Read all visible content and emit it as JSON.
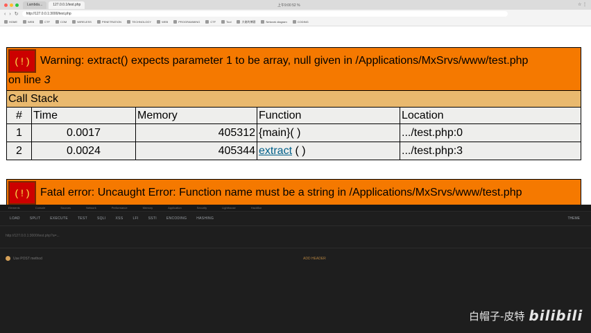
{
  "browser": {
    "tabs": [
      "Lambda...",
      "127.0.0.1/test.php"
    ],
    "active_tab_index": 1,
    "center_status": "上午9:00 52 %",
    "url": "http://127.0.0.1:3000/test.php",
    "nav": {
      "back": "‹",
      "forward": "›",
      "reload": "↻"
    },
    "right_icons": "☆ ⋮",
    "bookmarks": [
      "HOME",
      "WEB",
      "CTF",
      "COM",
      "WIRELESS",
      "PENETRATION",
      "TECHNOLOGY",
      "WEB",
      "PROGRAMMING",
      "CTF",
      "Tool",
      "大佬的博客",
      "Network diagram",
      "CODING"
    ]
  },
  "xdebug": {
    "warning": {
      "icon": "( ! )",
      "message": "Warning: extract() expects parameter 1 to be array, null given in /Applications/MxSrvs/www/test.php",
      "line_prefix": "on line ",
      "line": "3"
    },
    "call_stack_label": "Call Stack",
    "columns": [
      "#",
      "Time",
      "Memory",
      "Function",
      "Location"
    ],
    "rows": [
      {
        "num": "1",
        "time": "0.0017",
        "memory": "405312",
        "function": "{main}( )",
        "function_is_link": false,
        "location": ".../test.php:0"
      },
      {
        "num": "2",
        "time": "0.0024",
        "memory": "405344",
        "function": "extract",
        "function_suffix": " ( )",
        "function_is_link": true,
        "location": ".../test.php:3"
      }
    ],
    "fatal": {
      "icon": "( ! )",
      "message": "Fatal error: Uncaught Error: Function name must be a string in /Applications/MxSrvs/www/test.php"
    }
  },
  "devtools": {
    "tabs": [
      "Elements",
      "Console",
      "Sources",
      "Network",
      "Performance",
      "Memory",
      "Application",
      "Security",
      "Lighthouse",
      "HackBar"
    ],
    "toolbar": [
      "LOAD",
      "SPLIT",
      "EXECUTE",
      "TEST",
      "SQLI",
      "XSS",
      "LFI",
      "SSTI",
      "ENCODING",
      "HASHING"
    ],
    "theme_label": "THEME",
    "url_value": "http://127.0.0.1:3000/test.php?a=...",
    "post_label": "Use POST method",
    "add_header_label": "ADD HEADER"
  },
  "watermark": {
    "name": "白帽子-皮特",
    "logo": "bilibili"
  },
  "colors": {
    "warning_orange": "#f57900",
    "call_stack_tan": "#e9b96e",
    "cell_gray": "#eeeeec",
    "link_blue": "#00608a",
    "devtools_bg": "#1e1e1e"
  }
}
